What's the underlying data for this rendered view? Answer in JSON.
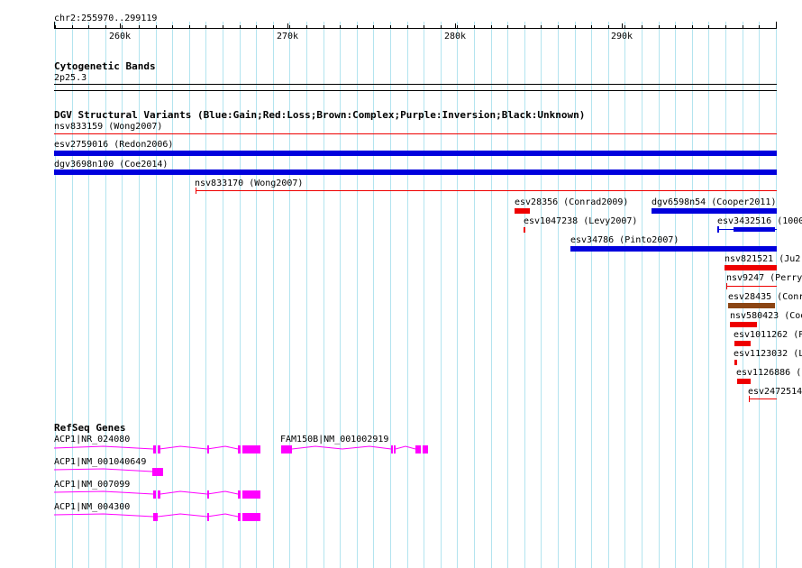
{
  "ruler": {
    "region": "chr2:255970..299119",
    "ticks": [
      "260k",
      "270k",
      "280k",
      "290k"
    ]
  },
  "cytobands": {
    "title": "Cytogenetic Bands",
    "band": "2p25.3"
  },
  "dgv": {
    "title": "DGV Structural Variants (Blue:Gain;Red:Loss;Brown:Complex;Purple:Inversion;Black:Unknown)",
    "colors": {
      "gain": "#0000dd",
      "loss": "#ee0000",
      "complex": "#8b4513"
    },
    "features": [
      {
        "label": "nsv833159 (Wong2007)",
        "type": "loss"
      },
      {
        "label": "esv2759016 (Redon2006)",
        "type": "gain"
      },
      {
        "label": "dgv3698n100 (Coe2014)",
        "type": "gain"
      },
      {
        "label": "nsv833170 (Wong2007)",
        "type": "loss"
      },
      {
        "label": "esv28356 (Conrad2009)",
        "type": "loss"
      },
      {
        "label": "dgv6598n54 (Cooper2011)",
        "type": "gain"
      },
      {
        "label": "esv1047238 (Levy2007)",
        "type": "loss"
      },
      {
        "label": "esv3432516 (1000",
        "type": "gain"
      },
      {
        "label": "esv34786 (Pinto2007)",
        "type": "gain"
      },
      {
        "label": "nsv821521 (Ju2",
        "type": "loss"
      },
      {
        "label": "nsv9247 (Perry",
        "type": "loss"
      },
      {
        "label": "esv28435 (Conr",
        "type": "complex"
      },
      {
        "label": "nsv580423 (Coo",
        "type": "loss"
      },
      {
        "label": "esv1011262 (P",
        "type": "loss"
      },
      {
        "label": "esv1123032 (L",
        "type": "loss"
      },
      {
        "label": "esv1126886 (",
        "type": "loss"
      },
      {
        "label": "esv2472514",
        "type": "loss"
      }
    ]
  },
  "refseq": {
    "title": "RefSeq Genes",
    "color": "#ff00ff",
    "genes": [
      {
        "label": "ACP1|NR_024080"
      },
      {
        "label": "FAM150B|NM_001002919"
      },
      {
        "label": "ACP1|NM_001040649"
      },
      {
        "label": "ACP1|NM_007099"
      },
      {
        "label": "ACP1|NM_004300"
      }
    ]
  }
}
